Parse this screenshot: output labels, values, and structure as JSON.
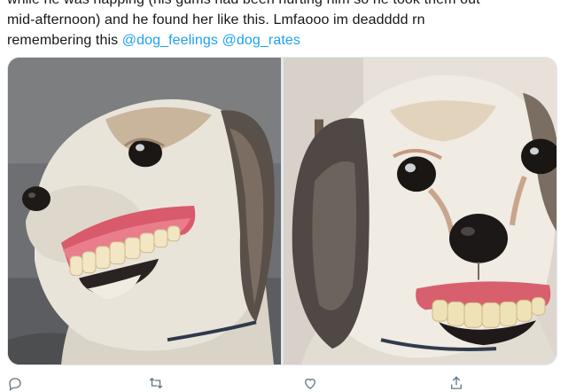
{
  "tweet": {
    "text_line_1": "while he was napping (his gums had been hurting him so he took them out",
    "text_line_2": "mid-afternoon) and he found her like this. Lmfaooo im deadddd rn",
    "text_line_3_prefix": "remembering this ",
    "mentions": [
      "@dog_feelings",
      "@dog_rates"
    ],
    "link_color": "#1da1f2"
  },
  "media": {
    "photos": [
      {
        "description_icon": "photo-dog-profile"
      },
      {
        "description_icon": "photo-dog-front"
      }
    ]
  },
  "actions": {
    "icons": [
      "reply-icon",
      "retweet-icon",
      "like-icon",
      "share-icon"
    ]
  }
}
